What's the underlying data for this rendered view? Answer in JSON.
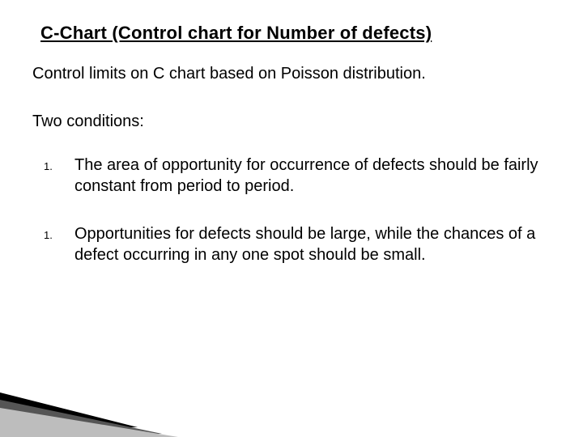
{
  "title": "C-Chart (Control chart for Number of defects)",
  "intro": "Control limits on C chart based on Poisson distribution.",
  "subhead": "Two conditions:",
  "items": [
    {
      "marker": "1.",
      "text": "The area of opportunity for occurrence of defects should be fairly constant from period to period."
    },
    {
      "marker": "1.",
      "text": "Opportunities for defects should be large, while the chances of a defect occurring in any one spot should be small."
    }
  ]
}
